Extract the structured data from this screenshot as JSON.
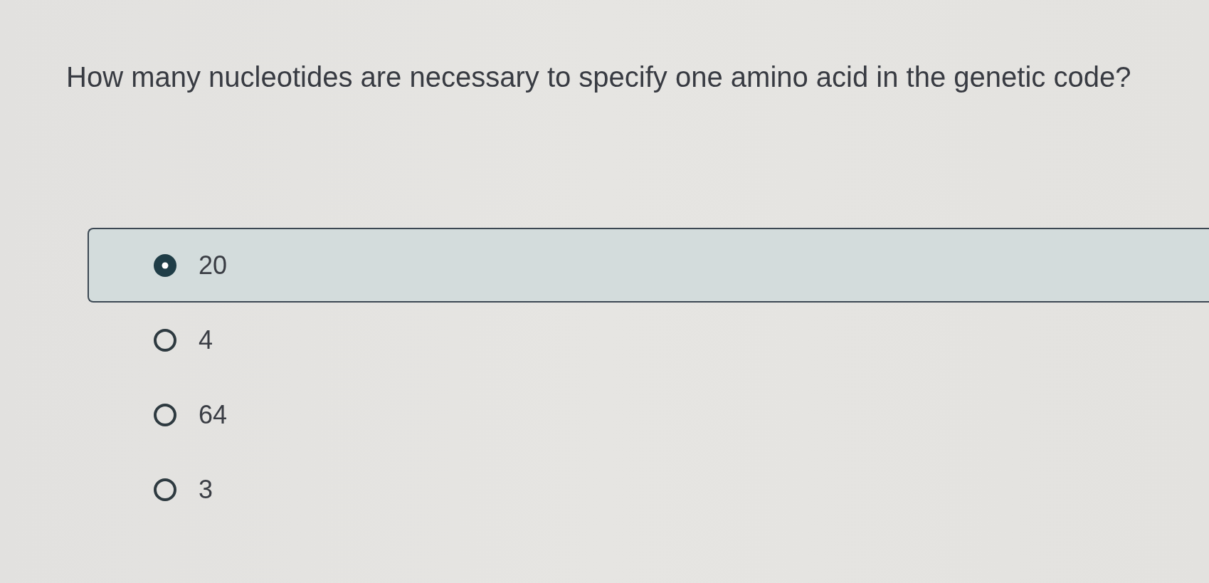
{
  "question": {
    "text": "How many nucleotides are necessary to specify one amino acid in the genetic code?"
  },
  "options": [
    {
      "label": "20",
      "selected": true
    },
    {
      "label": "4",
      "selected": false
    },
    {
      "label": "64",
      "selected": false
    },
    {
      "label": "3",
      "selected": false
    }
  ]
}
